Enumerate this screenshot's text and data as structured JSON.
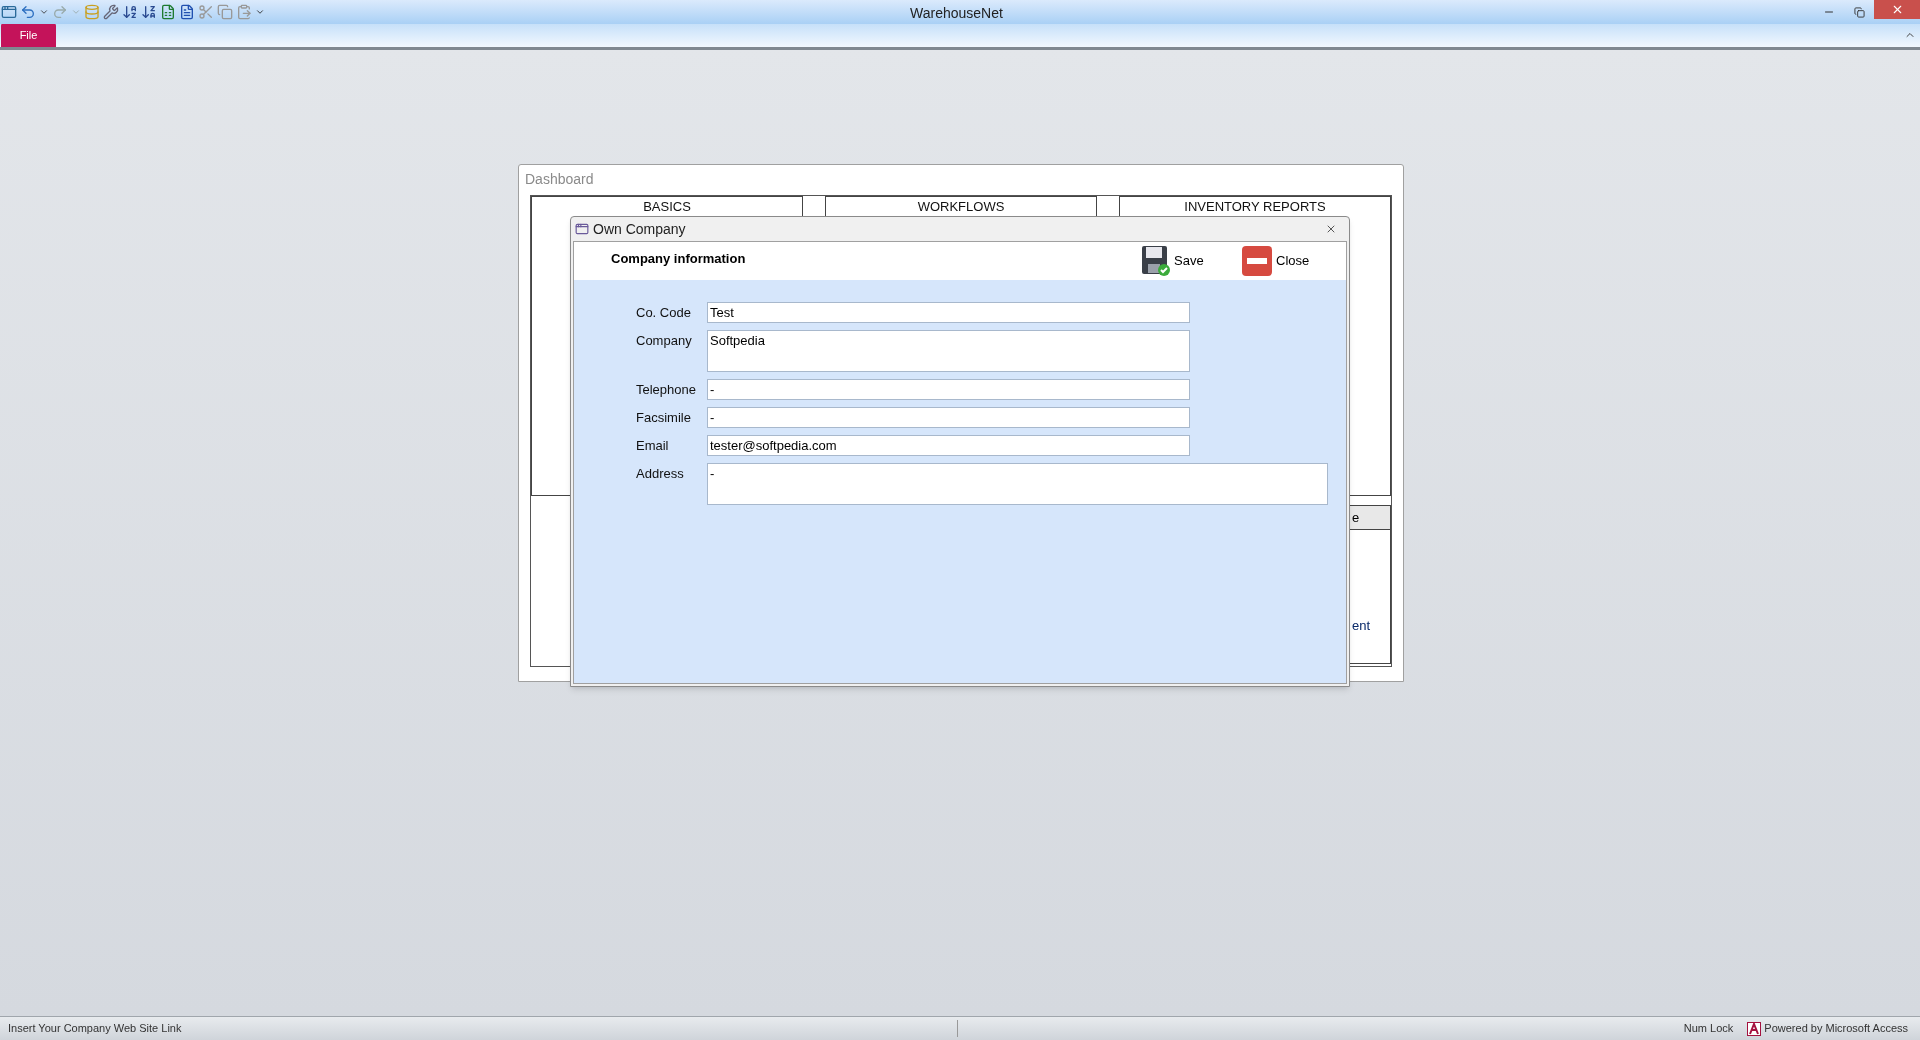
{
  "window": {
    "title": "WarehouseNet"
  },
  "ribbon": {
    "file_tab": "File"
  },
  "dashboard": {
    "title": "Dashboard",
    "sections": [
      "BASICS",
      "WORKFLOWS",
      "INVENTORY REPORTS"
    ],
    "hidden_panel": {
      "header": "e",
      "item": "ent"
    }
  },
  "dialog": {
    "title": "Own Company",
    "heading": "Company information",
    "buttons": [
      {
        "kind": "save",
        "label": "Save"
      },
      {
        "kind": "close",
        "label": "Close"
      }
    ],
    "fields": [
      {
        "label": "Co. Code",
        "value": "Test",
        "kind": "line"
      },
      {
        "label": "Company",
        "value": "Softpedia",
        "kind": "box"
      },
      {
        "label": "Telephone",
        "value": "-",
        "kind": "line"
      },
      {
        "label": "Facsimile",
        "value": "-",
        "kind": "line"
      },
      {
        "label": "Email",
        "value": "tester@softpedia.com",
        "kind": "line"
      },
      {
        "label": "Address",
        "value": "-",
        "kind": "wide_box"
      }
    ]
  },
  "status_bar": {
    "message": "Insert Your Company Web Site Link",
    "num_lock": "Num Lock",
    "powered_by": "Powered by Microsoft Access"
  }
}
